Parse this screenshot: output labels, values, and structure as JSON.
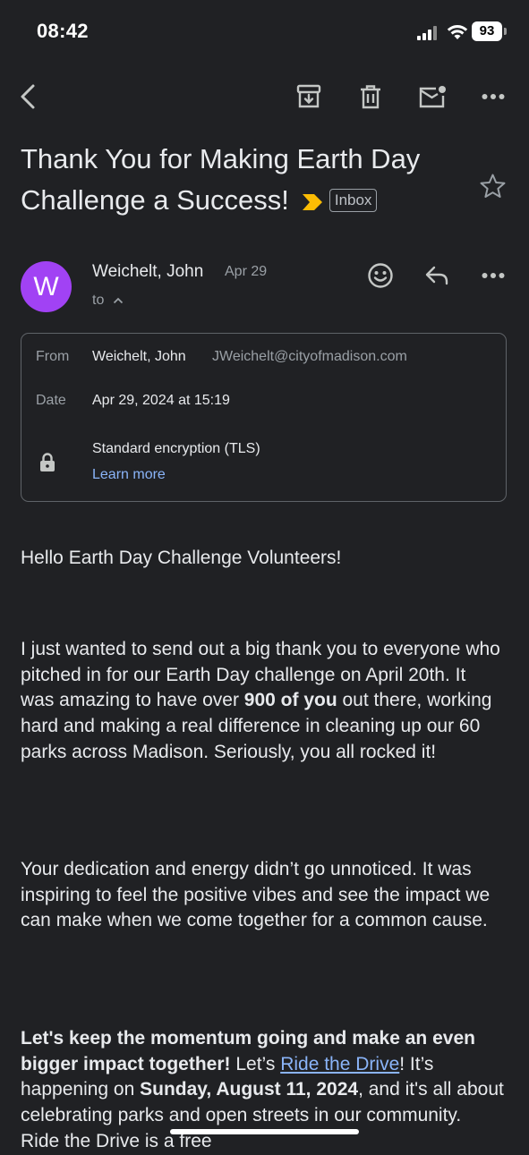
{
  "status_bar": {
    "time": "08:42",
    "battery": "93"
  },
  "toolbar": {
    "back": "chevron-left-icon",
    "archive": "archive-icon",
    "delete": "trash-icon",
    "mark_unread": "mail-unread-icon",
    "more": "more-horizontal-icon"
  },
  "email": {
    "subject": "Thank You for Making Earth Day Challenge a Success!",
    "label": "Inbox",
    "importance_color": "#fbbc04",
    "sender": {
      "initial": "W",
      "name": "Weichelt, John",
      "date": "Apr 29",
      "to": "to",
      "avatar_color": "#a142f4"
    },
    "details": {
      "from_label": "From",
      "from_name": "Weichelt, John",
      "from_email": "JWeichelt@cityofmadison.com",
      "date_label": "Date",
      "date_value": "Apr 29, 2024 at 15:19",
      "encryption": "Standard encryption (TLS)",
      "learn_more": "Learn more"
    },
    "body": {
      "greeting": "Hello Earth Day Challenge Volunteers!",
      "p1_a": "I just wanted to send out a big thank you to everyone who pitched in for our Earth Day challenge on April 20th. It was amazing to have over ",
      "p1_bold": "900 of you",
      "p1_b": " out there, working hard and making a real difference in cleaning up our 60 parks across Madison. Seriously, you all rocked it!",
      "p2": "Your dedication and energy didn’t go unnoticed. It was inspiring to feel the positive vibes and see the impact we can make when we come together for a common cause.",
      "p3_bold": "Let's keep the momentum going and make an even bigger impact together!",
      "p3_a": " Let’s ",
      "p3_link": "Ride the Drive",
      "p3_b": "! It’s happening on ",
      "p3_date": "Sunday, August 11, 2024",
      "p3_c": ", and it's all about celebrating parks and open streets in our community. Ride the Drive is a free"
    }
  }
}
